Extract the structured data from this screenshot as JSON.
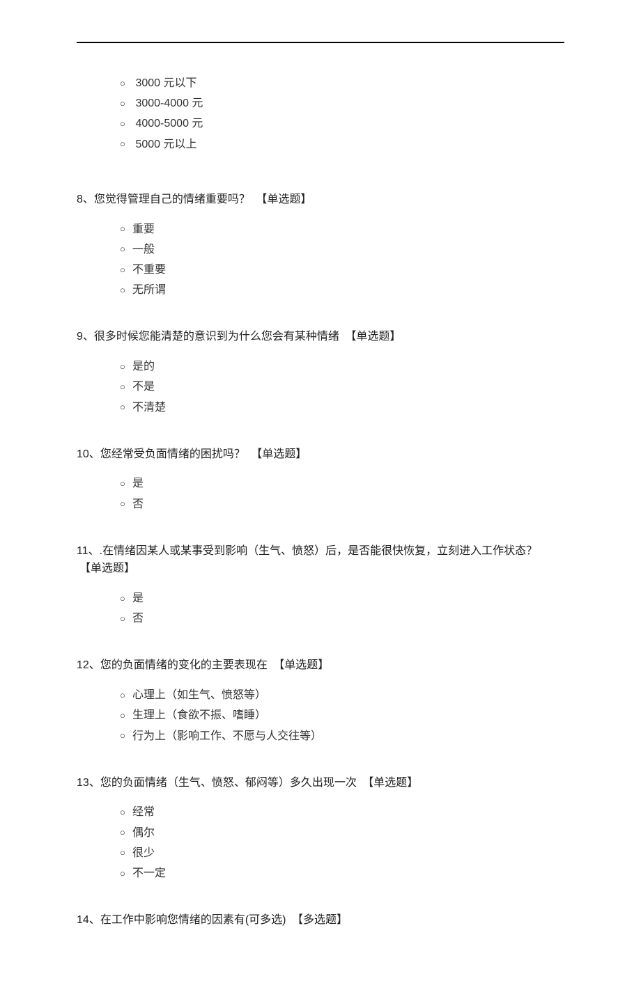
{
  "tags": {
    "single": "【单选题】",
    "multi": "【多选题】"
  },
  "bullet": "○",
  "intro_options": [
    "3000 元以下",
    "3000-4000 元",
    "4000-5000 元",
    "5000 元以上"
  ],
  "questions": [
    {
      "num": "8、",
      "text": "您觉得管理自己的情绪重要吗？",
      "tag": "single",
      "options": [
        "重要",
        "一般",
        "不重要",
        "无所谓"
      ]
    },
    {
      "num": "9、",
      "text": "很多时候您能清楚的意识到为什么您会有某种情绪",
      "tag": "single",
      "options": [
        "是的",
        "不是",
        "不清楚"
      ]
    },
    {
      "num": "10、",
      "text": "您经常受负面情绪的困扰吗？",
      "tag": "single",
      "options": [
        "是",
        "否"
      ]
    },
    {
      "num": "11、",
      "text": ".在情绪因某人或某事受到影响（生气、愤怒）后，是否能很快恢复，立刻进入工作状态？",
      "tag": "single",
      "options": [
        "是",
        "否"
      ]
    },
    {
      "num": "12、",
      "text": "您的负面情绪的变化的主要表现在",
      "tag": "single",
      "options": [
        "心理上（如生气、愤怒等）",
        "生理上（食欲不振、嗜睡）",
        "行为上（影响工作、不愿与人交往等）"
      ]
    },
    {
      "num": "13、",
      "text": "您的负面情绪（生气、愤怒、郁闷等）多久出现一次",
      "tag": "single",
      "options": [
        "经常",
        "偶尔",
        "很少",
        "不一定"
      ]
    },
    {
      "num": "14、",
      "text": "在工作中影响您情绪的因素有(可多选)",
      "tag": "multi",
      "options": []
    }
  ]
}
